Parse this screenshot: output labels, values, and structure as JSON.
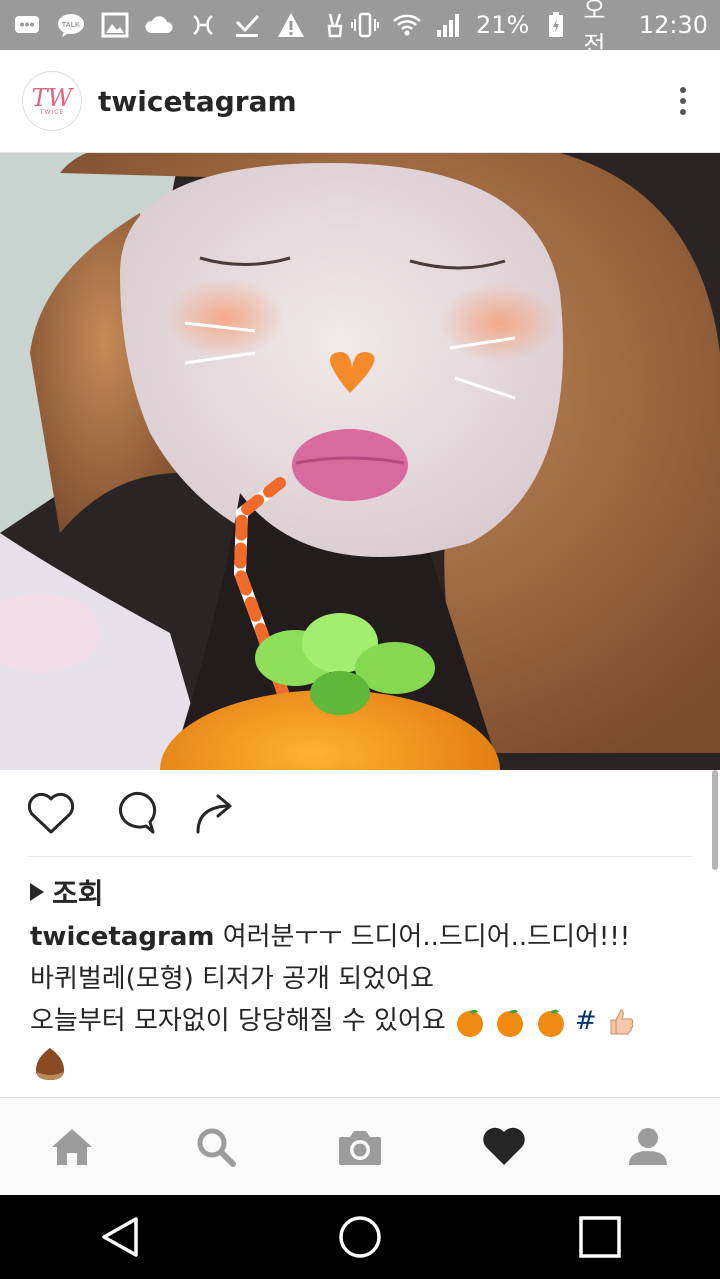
{
  "status_bar": {
    "battery": "21%",
    "ampm": "오전",
    "time": "12:30",
    "icons": [
      "chat-icon",
      "talk-icon",
      "image-icon",
      "cloud-icon",
      "twitter-icon",
      "download-icon",
      "warning-icon",
      "victory-icon",
      "vibrate-icon",
      "wifi-icon",
      "signal-icon",
      "battery-icon"
    ]
  },
  "header": {
    "username": "twicetagram",
    "avatar_logo": "TW",
    "avatar_sub": "TWICE"
  },
  "post": {
    "views_label": "조회",
    "caption_user": "twicetagram",
    "caption_line1": "여러분ㅜㅜ 드디어..드디어..드디어!!!",
    "caption_line2": "바퀴벌레(모형) 티저가 공개 되었어요",
    "caption_line3": "오늘부터 모자없이 당당해질 수 있어요",
    "hashtag": "#"
  },
  "colors": {
    "status_bar": "#9a9a9a",
    "hashtag": "#003569",
    "tab_icon": "#9c9c9c",
    "tab_active": "#262626"
  },
  "tabs": [
    {
      "name": "home-icon"
    },
    {
      "name": "search-icon"
    },
    {
      "name": "camera-icon"
    },
    {
      "name": "heart-icon",
      "active": true
    },
    {
      "name": "profile-icon"
    }
  ],
  "nav": [
    "back-icon",
    "home-circle-icon",
    "recents-icon"
  ]
}
